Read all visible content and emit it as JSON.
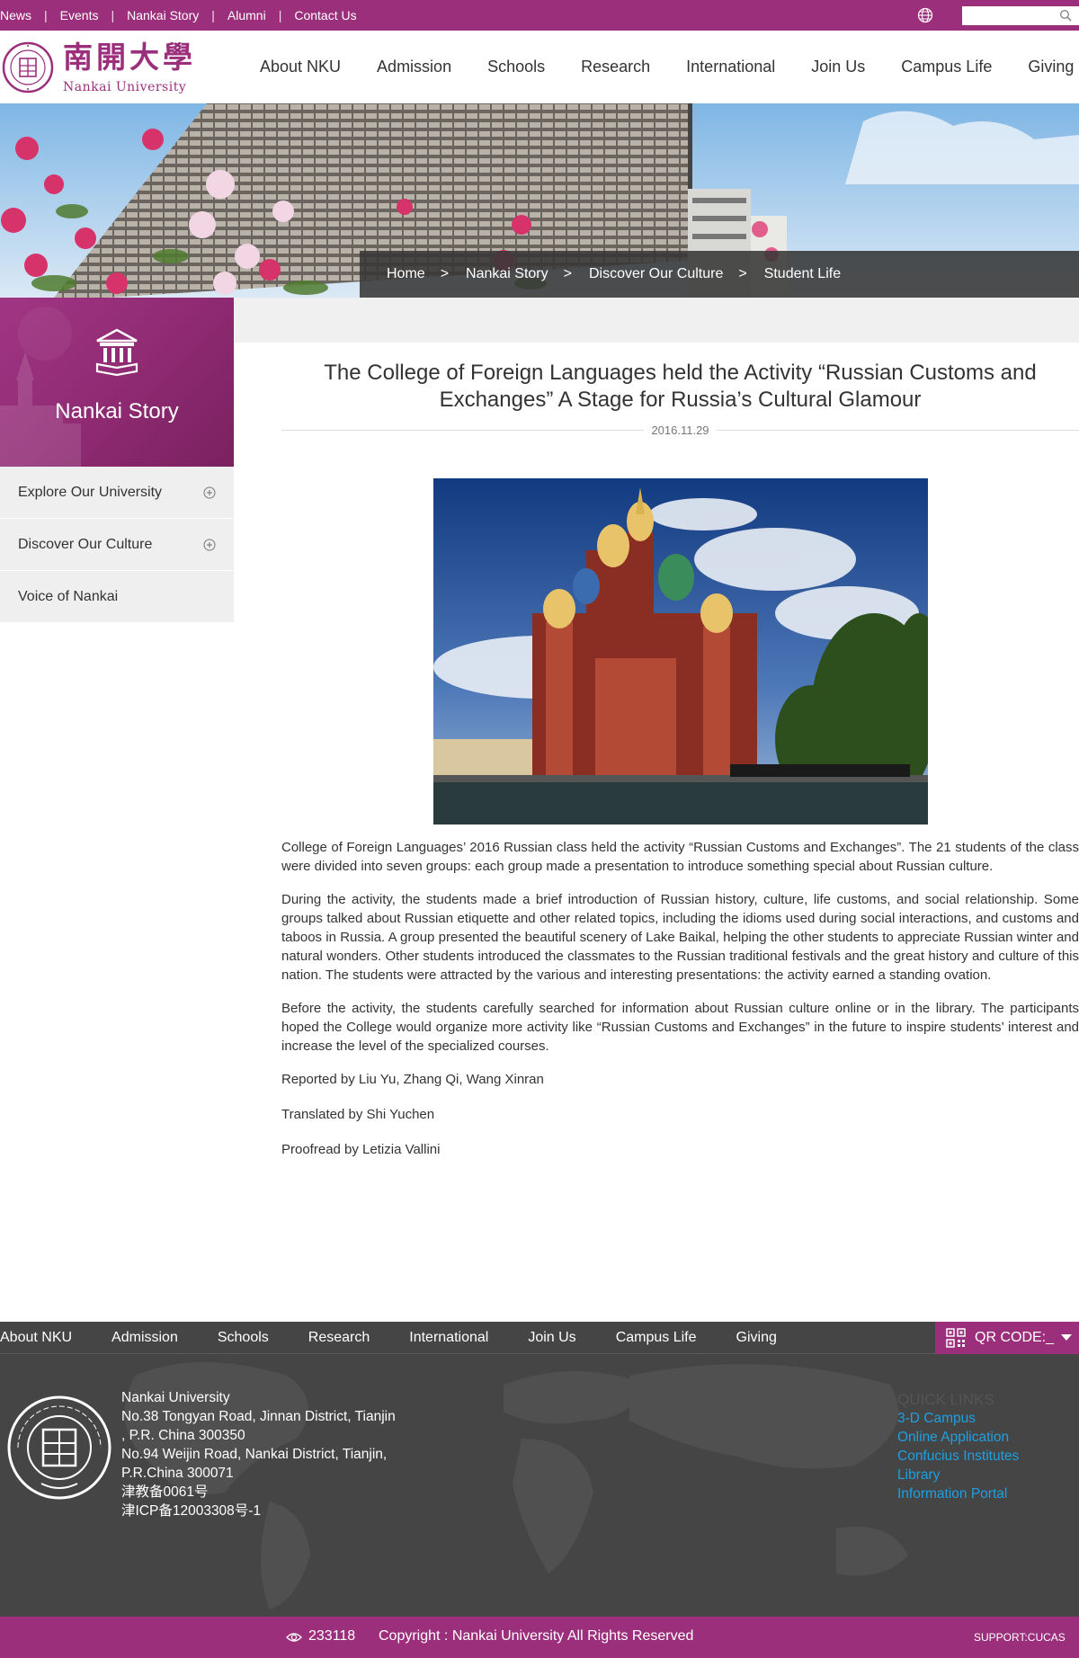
{
  "topbar": {
    "links": [
      "News",
      "Events",
      "Nankai Story",
      "Alumni",
      "Contact Us"
    ],
    "search_placeholder": ""
  },
  "header": {
    "logo_cn": "南開大學",
    "logo_en": "Nankai University",
    "nav": [
      "About NKU",
      "Admission",
      "Schools",
      "Research",
      "International",
      "Join Us",
      "Campus Life",
      "Giving"
    ]
  },
  "breadcrumb": [
    "Home",
    "Nankai Story",
    "Discover Our Culture",
    "Student Life"
  ],
  "sidebar": {
    "title": "Nankai Story",
    "items": [
      {
        "label": "Explore Our University",
        "expandable": true
      },
      {
        "label": "Discover Our Culture",
        "expandable": true
      },
      {
        "label": "Voice of Nankai",
        "expandable": false
      }
    ]
  },
  "article": {
    "title": "The College of Foreign Languages held the Activity “Russian Customs and Exchanges” A Stage for Russia’s Cultural Glamour",
    "date": "2016.11.29",
    "paragraphs": [
      "College of Foreign Languages’ 2016 Russian class held the activity “Russian Customs and Exchanges”. The 21 students of the class were divided into seven groups: each group made a presentation to introduce something special about Russian culture.",
      "During the activity, the students made a brief introduction of Russian history, culture, life customs, and social relationship. Some groups talked about Russian etiquette and other related topics, including the idioms used during social interactions, and customs and taboos in Russia. A group presented the beautiful scenery of Lake Baikal, helping the other students to appreciate Russian winter and natural wonders. Other students introduced the classmates to the Russian traditional festivals and the great history and culture of this nation. The students were attracted by the various and interesting presentations: the activity earned a standing ovation.",
      "Before the activity, the students carefully searched for information about Russian culture online or in the library. The participants hoped the College would organize more activity like “Russian Customs and Exchanges” in the future to inspire students’ interest and increase the level of the specialized courses."
    ],
    "credits": [
      "Reported by Liu Yu, Zhang Qi, Wang Xinran",
      "Translated by Shi Yuchen",
      "Proofread by Letizia Vallini"
    ]
  },
  "footer": {
    "nav": [
      "About NKU",
      "Admission",
      "Schools",
      "Research",
      "International",
      "Join Us",
      "Campus Life",
      "Giving"
    ],
    "qr_label": "QR CODE:_",
    "address_lines": [
      "Nankai University",
      "No.38 Tongyan Road, Jinnan District, Tianjin",
      ", P.R. China 300350",
      "No.94 Weijin Road,  Nankai District, Tianjin,",
      "P.R.China  300071",
      "津教备0061号",
      "津ICP备12003308号-1"
    ],
    "quick_links_title": "QUICK LINKS",
    "quick_links": [
      "3-D Campus",
      "Online Application",
      "Confucius Institutes",
      "Library",
      "Information Portal"
    ],
    "visit_count": "233118",
    "copyright": "Copyright : Nankai University All Rights Reserved",
    "support": "SUPPORT:CUCAS"
  },
  "colors": {
    "brand": "#9b2f7c",
    "footer_bg": "#454545",
    "link_blue": "#1ea0e0"
  },
  "icons": [
    "globe-icon",
    "search-icon",
    "library-icon",
    "plus-circle-icon",
    "qr-code-icon",
    "eye-icon"
  ]
}
